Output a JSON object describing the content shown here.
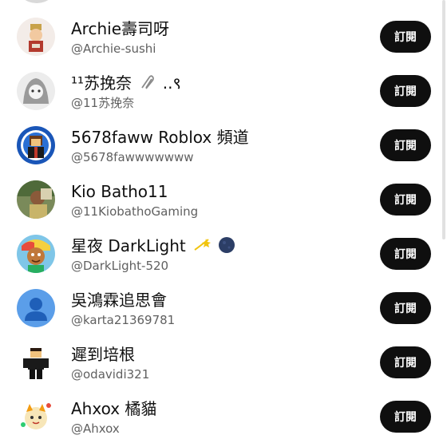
{
  "subscribe_label": "訂閱",
  "channels": [
    {
      "name": "Archie壽司呀",
      "handle": "@Archie-sushi",
      "avatar": "archie-avatar"
    },
    {
      "name": "¹¹苏挽奈",
      "name_suffix": "..९",
      "handle": "@11苏挽奈",
      "avatar": "11-avatar"
    },
    {
      "name": "5678faww Roblox 頻道",
      "handle": "@5678fawwwwwww",
      "avatar": "5678-avatar"
    },
    {
      "name": "Kio Batho11",
      "handle": "@11KiobathoGaming",
      "avatar": "kio-avatar"
    },
    {
      "name": "星夜 DarkLight",
      "handle": "@DarkLight-520",
      "avatar": "darklight-avatar"
    },
    {
      "name": "吳鴻霖追思會",
      "handle": "@karta21369781",
      "avatar": "default-person-avatar"
    },
    {
      "name": "遲到培根",
      "handle": "@odavidi321",
      "avatar": "roblox-avatar"
    },
    {
      "name": "Ahxox 橘貓",
      "handle": "@Ahxox",
      "avatar": "ahxox-avatar"
    }
  ],
  "colors": {
    "button_bg": "#0f0f0f",
    "button_text": "#ffffff",
    "secondary_text": "#606060",
    "default_avatar": "#5b9ee9"
  }
}
